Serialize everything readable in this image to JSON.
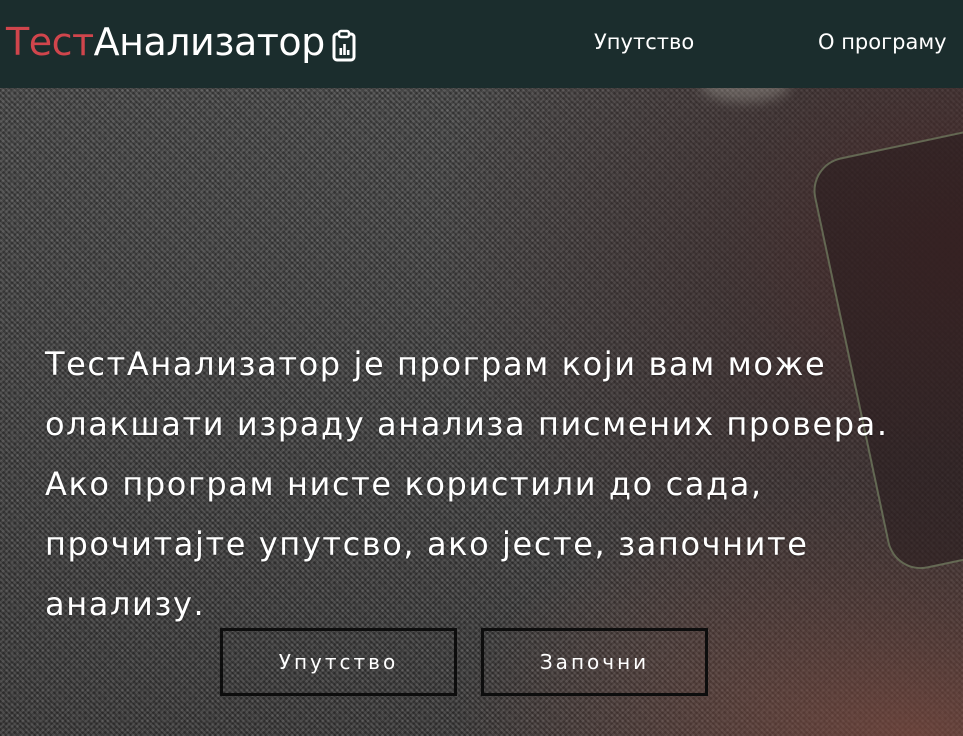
{
  "navbar": {
    "brand_first": "Тест",
    "brand_second": "Анализатор",
    "brand_icon": "clipboard-chart-icon",
    "links": [
      {
        "label": "Упутство"
      },
      {
        "label": "О програму"
      }
    ],
    "background_color": "#1b2d2d",
    "brand_accent_color": "#d0454c"
  },
  "hero": {
    "text": "ТестАнализатор је програм који вам може олакшати израду анализа писмених провера. Ако програм нисте користили до сада, прочитајте упутсво, ако јесте, започните анализу.",
    "buttons": [
      {
        "label": "Упутство"
      },
      {
        "label": "Започни"
      }
    ]
  }
}
